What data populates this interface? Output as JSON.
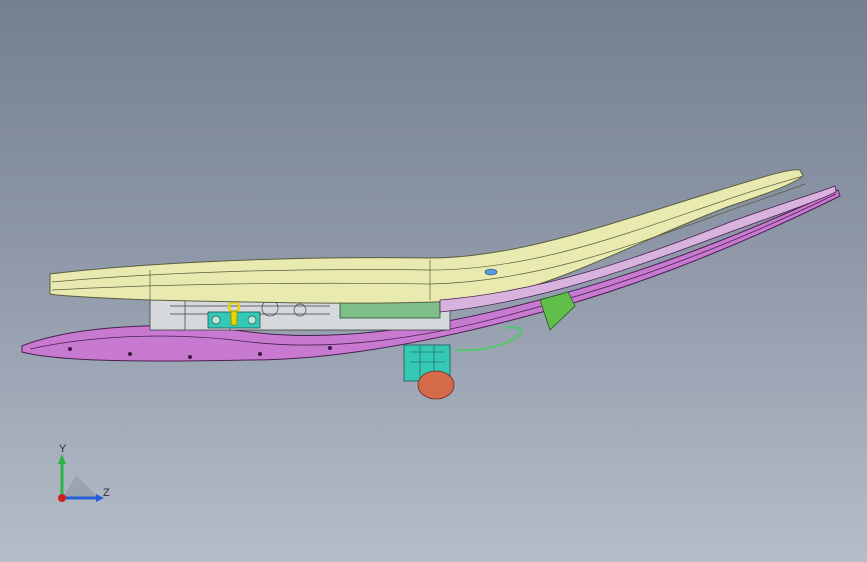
{
  "viewport": {
    "background_top": "#747f92",
    "background_bottom": "#b5bdc8"
  },
  "model": {
    "seat_cushion_color": "#e8eab0",
    "seat_outline_color": "#5b5e3e",
    "lower_frame_color": "#c77ad0",
    "bracket_color": "#35c9b5",
    "harness_wire_color": "#4fc96a",
    "connector_body_color": "#d56a4a"
  },
  "triad": {
    "y_label": "Y",
    "z_label": "Z",
    "y_color": "#2db34a",
    "z_color": "#2a5bd8",
    "x_color": "#d02020",
    "x_cone_color": "#9aa3b0"
  }
}
